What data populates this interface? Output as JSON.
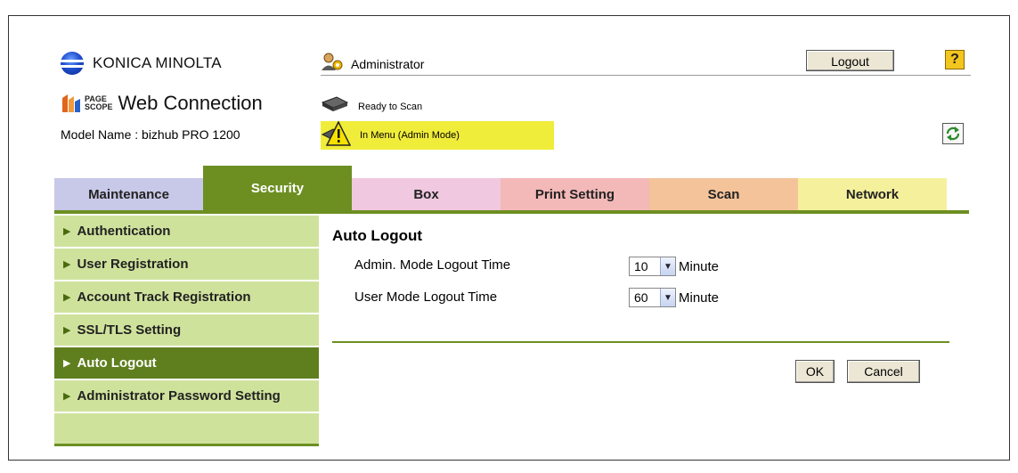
{
  "header": {
    "brand": "KONICA MINOLTA",
    "pagescope_small_1": "PAGE",
    "pagescope_small_2": "SCOPE",
    "product": "Web Connection",
    "model": "Model Name : bizhub PRO 1200",
    "user_role": "Administrator",
    "logout_label": "Logout",
    "help_label": "?",
    "status_ready": "Ready to Scan",
    "status_menu": "In Menu (Admin Mode)"
  },
  "tabs": [
    {
      "label": "Maintenance"
    },
    {
      "label": "Security"
    },
    {
      "label": "Box"
    },
    {
      "label": "Print Setting"
    },
    {
      "label": "Scan"
    },
    {
      "label": "Network"
    }
  ],
  "sidebar": {
    "items": [
      {
        "label": "Authentication"
      },
      {
        "label": "User Registration"
      },
      {
        "label": "Account Track Registration"
      },
      {
        "label": "SSL/TLS Setting"
      },
      {
        "label": "Auto Logout"
      },
      {
        "label": "Administrator Password Setting"
      }
    ],
    "active_index": 4
  },
  "main": {
    "title": "Auto Logout",
    "fields": [
      {
        "label": "Admin. Mode Logout Time",
        "value": "10",
        "unit": "Minute"
      },
      {
        "label": "User Mode Logout Time",
        "value": "60",
        "unit": "Minute"
      }
    ],
    "ok_label": "OK",
    "cancel_label": "Cancel"
  },
  "colors": {
    "security_green": "#6d8f22",
    "sidebar_green": "#cfe29c",
    "status_yellow": "#f0ec3a"
  }
}
